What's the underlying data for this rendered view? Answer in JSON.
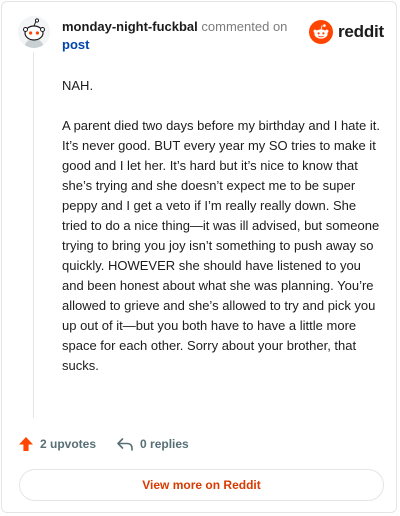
{
  "header": {
    "author": "monday-night-fuckbal",
    "commented_on": "commented on",
    "post_link": "post",
    "brand": "reddit"
  },
  "comment": {
    "paragraphs": [
      "NAH.",
      "A parent died two days before my birthday and I hate it. It’s never good. BUT every year my SO tries to make it good and I let her. It’s hard but it’s nice to know that she’s trying and she doesn’t expect me to be super peppy and I get a veto if I’m really really down. She tried to do a nice thing—it was ill advised, but someone trying to bring you joy isn’t something to push away so quickly. HOWEVER she should have listened to you and been honest about what she was planning. You’re allowed to grieve and she’s allowed to try and pick you up out of it—but you both have to have a little more space for each other. Sorry about your brother, that sucks."
    ]
  },
  "footer": {
    "upvotes": "2 upvotes",
    "replies": "0 replies",
    "upvote_icon": "upvote-arrow-icon",
    "reply_icon": "reply-arrow-icon"
  },
  "cta": {
    "label": "View more on Reddit"
  },
  "colors": {
    "brand_orange": "#ff4500",
    "link_blue": "#0045ac",
    "cta_text": "#d93a00",
    "muted": "#576f76"
  }
}
